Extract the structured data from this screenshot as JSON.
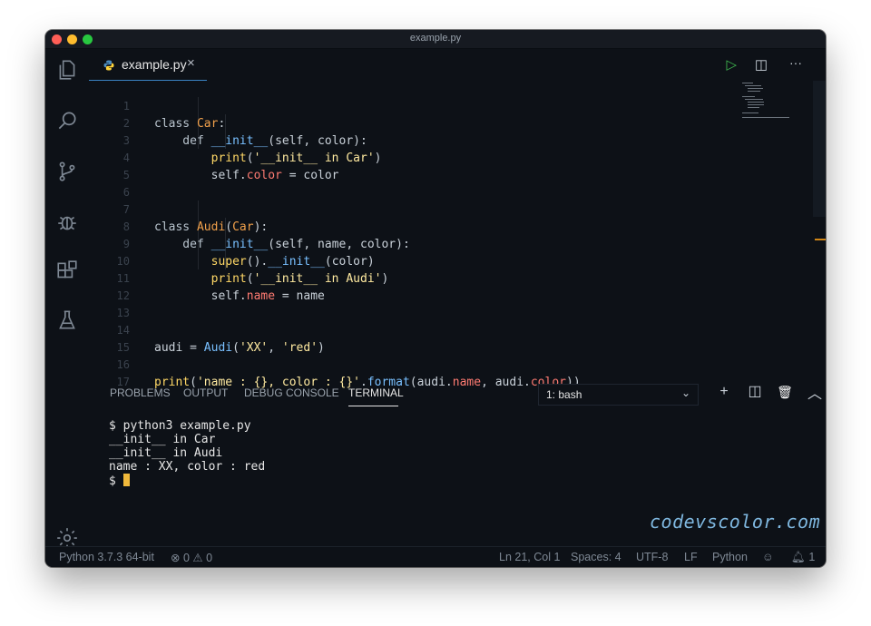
{
  "window": {
    "title": "example.py"
  },
  "activity_bar": {
    "icons": [
      "files-icon",
      "search-icon",
      "source-control-icon",
      "debug-icon",
      "extensions-icon",
      "testing-icon",
      "settings-gear-icon"
    ]
  },
  "tab": {
    "label": "example.py",
    "close": "×"
  },
  "editor_actions": {
    "run": "▷",
    "split": "◫",
    "more": "···"
  },
  "code_lines": [
    {
      "n": "1"
    },
    {
      "n": "2"
    },
    {
      "n": "3"
    },
    {
      "n": "4"
    },
    {
      "n": "5"
    },
    {
      "n": "6"
    },
    {
      "n": "7"
    },
    {
      "n": "8"
    },
    {
      "n": "9"
    },
    {
      "n": "10"
    },
    {
      "n": "11"
    },
    {
      "n": "12"
    },
    {
      "n": "13"
    },
    {
      "n": "14"
    },
    {
      "n": "15"
    },
    {
      "n": "16"
    },
    {
      "n": "17"
    }
  ],
  "code": {
    "l1": [
      "class ",
      "Car",
      ":"
    ],
    "l2": [
      "    def ",
      "__init__",
      "(self, color):"
    ],
    "l3": [
      "        ",
      "print",
      "(",
      "'__init__ in Car'",
      ")"
    ],
    "l4": [
      "        self.",
      "color",
      " = color"
    ],
    "l7": [
      "class ",
      "Audi",
      "(",
      "Car",
      "):"
    ],
    "l8": [
      "    def ",
      "__init__",
      "(self, name, color):"
    ],
    "l9": [
      "        ",
      "super",
      "().",
      "__init__",
      "(color)"
    ],
    "l10": [
      "        ",
      "print",
      "(",
      "'__init__ in Audi'",
      ")"
    ],
    "l11": [
      "        self.",
      "name",
      " = name"
    ],
    "l14": [
      "audi = ",
      "Audi",
      "(",
      "'XX'",
      ", ",
      "'red'",
      ")"
    ],
    "l16": [
      "print",
      "(",
      "'name : {}, color : {}'",
      ".",
      "format",
      "(audi.",
      "name",
      ", audi.",
      "color",
      "))"
    ]
  },
  "panel": {
    "tabs": [
      "PROBLEMS",
      "OUTPUT",
      "DEBUG CONSOLE",
      "TERMINAL"
    ],
    "active_tab": "TERMINAL",
    "terminal_select": "1: bash",
    "icons": {
      "add": "+",
      "split": "◫",
      "trash": "🗑",
      "maximize": "︿",
      "close": "×"
    }
  },
  "terminal": {
    "lines": [
      "$ python3 example.py",
      "__init__ in Car",
      "__init__ in Audi",
      "name : XX, color : red",
      "$ "
    ]
  },
  "watermark": "codevscolor.com",
  "status_bar": {
    "python": "Python 3.7.3 64-bit",
    "errors": "0",
    "warnings": "0",
    "position": "Ln 21, Col 1",
    "spaces": "Spaces: 4",
    "encoding": "UTF-8",
    "eol": "LF",
    "language": "Python",
    "notifications": "1"
  },
  "colors": {
    "background": "#0d1117",
    "class_name": "#f0a04b",
    "function": "#79c0ff",
    "builtin": "#ffd866",
    "string": "#ffeaa0",
    "attribute": "#ff7b72",
    "cursor": "#f0b93b"
  }
}
